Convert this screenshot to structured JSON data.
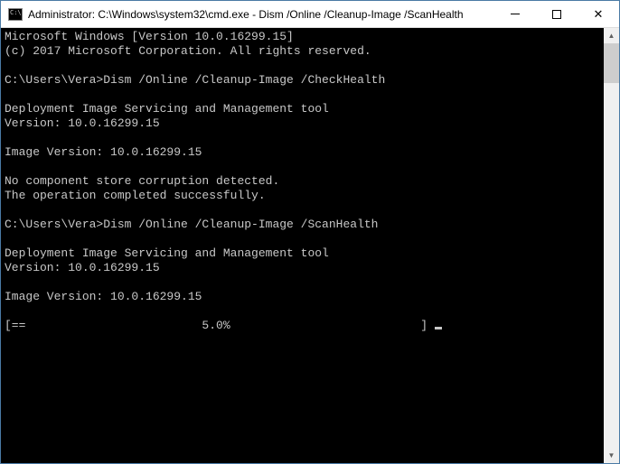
{
  "titlebar": {
    "title": "Administrator: C:\\Windows\\system32\\cmd.exe - Dism  /Online /Cleanup-Image /ScanHealth"
  },
  "terminal": {
    "lines": [
      "Microsoft Windows [Version 10.0.16299.15]",
      "(c) 2017 Microsoft Corporation. All rights reserved.",
      "",
      "C:\\Users\\Vera>Dism /Online /Cleanup-Image /CheckHealth",
      "",
      "Deployment Image Servicing and Management tool",
      "Version: 10.0.16299.15",
      "",
      "Image Version: 10.0.16299.15",
      "",
      "No component store corruption detected.",
      "The operation completed successfully.",
      "",
      "C:\\Users\\Vera>Dism /Online /Cleanup-Image /ScanHealth",
      "",
      "Deployment Image Servicing and Management tool",
      "Version: 10.0.16299.15",
      "",
      "Image Version: 10.0.16299.15",
      ""
    ],
    "progress_line": "[==                         5.0%                           ] "
  }
}
